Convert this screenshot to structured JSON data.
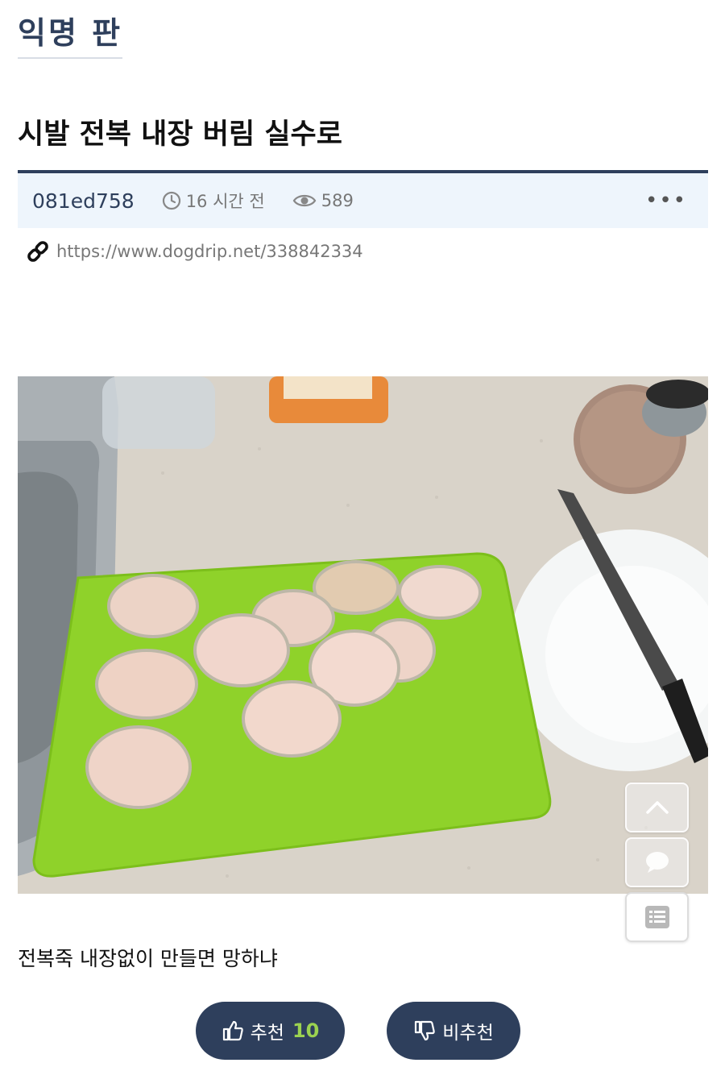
{
  "board": {
    "title": "익명 판"
  },
  "post": {
    "title": "시발 전복 내장 버림 실수로",
    "author": "081ed758",
    "time": "16 시간 전",
    "views": "589",
    "url": "https://www.dogdrip.net/338842334",
    "body": "전복죽 내장없이 만들면 망하냐"
  },
  "votes": {
    "up_label": "추천",
    "up_count": "10",
    "down_label": "비추천"
  },
  "icons": {
    "clock": "clock-icon",
    "eye": "eye-icon",
    "link": "link-icon",
    "thumbs_up": "thumbs-up-icon",
    "thumbs_down": "thumbs-down-icon",
    "more": "more-icon",
    "scroll_top": "chevron-up-icon",
    "comment": "comment-icon",
    "list": "list-icon"
  },
  "colors": {
    "primary": "#2e3f5c",
    "meta_bg": "#eef5fc",
    "vote_count": "#9bd250"
  }
}
